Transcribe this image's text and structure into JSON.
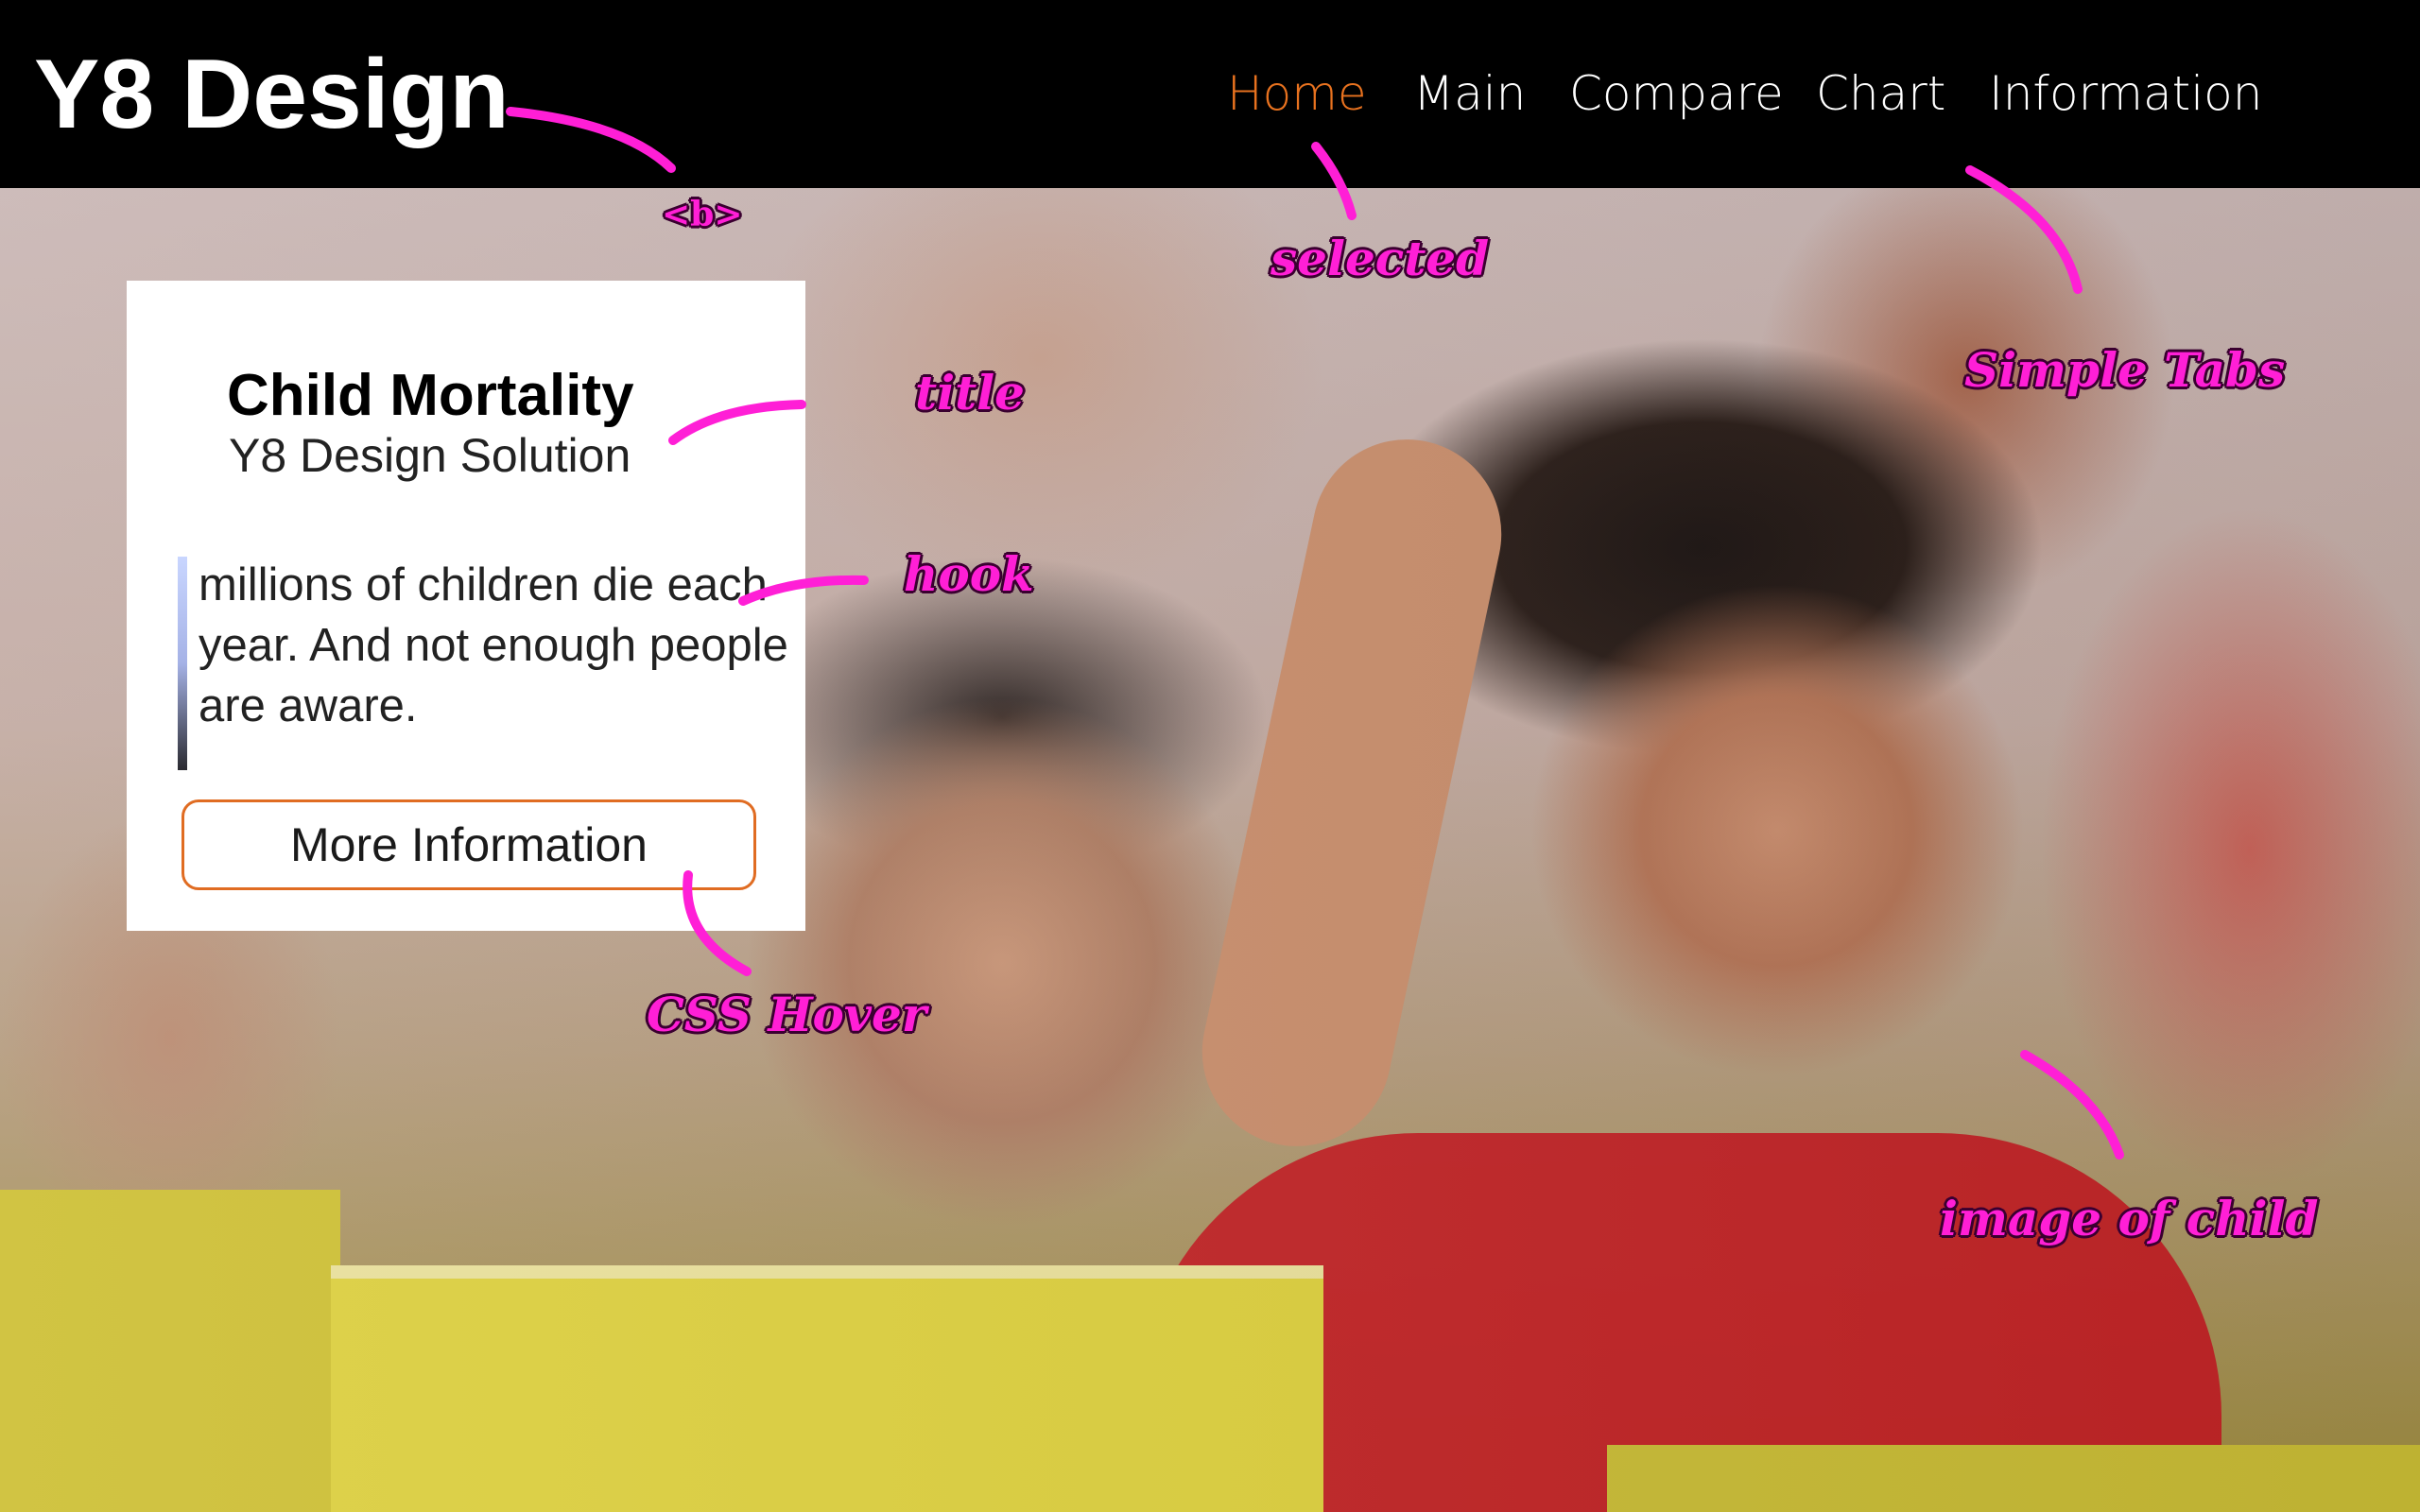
{
  "header": {
    "brand": "Y8 Design",
    "tabs": [
      {
        "label": "Home",
        "selected": true
      },
      {
        "label": "Main",
        "selected": false
      },
      {
        "label": "Compare",
        "selected": false
      },
      {
        "label": "Chart",
        "selected": false
      },
      {
        "label": "Information",
        "selected": false
      }
    ]
  },
  "card": {
    "title": "Child Mortality",
    "subtitle": "Y8 Design Solution",
    "hook": "millions of children die each year. And not enough people are aware.",
    "button_label": "More Information"
  },
  "annotations": {
    "b_tag": "<b>",
    "selected": "selected",
    "simple_tabs": "Simple Tabs",
    "title": "title",
    "hook": "hook",
    "css_hover": "CSS Hover",
    "image_of_child": "image of child"
  },
  "colors": {
    "selected_tab": "#e8721f",
    "button_border": "#e06c22",
    "annotation": "#ff1fd6",
    "navbar_bg": "#000000"
  }
}
